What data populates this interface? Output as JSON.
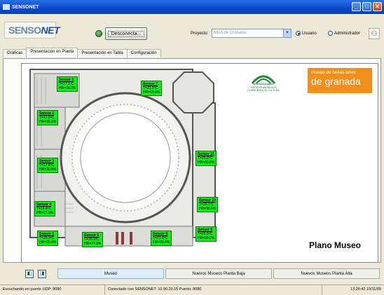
{
  "window": {
    "title": "SENSONET"
  },
  "toolbar": {
    "logo_main": "SENSO",
    "logo_accent": "NET",
    "disconnect_label": "Desconecta...",
    "project_label": "Proyecto:",
    "project_value": "MBA de Granada",
    "role_options": [
      "Usuario",
      "Administrador"
    ],
    "role_selected": "Usuario"
  },
  "tabs": [
    {
      "label": "Gráficas"
    },
    {
      "label": "Presentación en Planta"
    },
    {
      "label": "Presentación en Tabla"
    },
    {
      "label": "Configuración"
    }
  ],
  "active_tab": "Presentación en Planta",
  "plan": {
    "title": "Plano Museo",
    "logo_institution": "JUNTA DE ANDALUCIA",
    "logo_department": "CONSEJERÍA DE CULTURA",
    "museo_line1": "museo de bellas artes",
    "museo_line2": "de granada"
  },
  "sensors": [
    {
      "name": "Sensor 1",
      "t": "T=17.1ºC",
      "h": "HR=36.3%"
    },
    {
      "name": "Sensor 2",
      "t": "T=17.9ºC",
      "h": "HR=36.2%"
    },
    {
      "name": "Sensor 3",
      "t": "T=17.8ºC",
      "h": "HR=30.8%"
    },
    {
      "name": "Sensor 4",
      "t": "T=16.9ºC",
      "h": "HR=27.5%"
    },
    {
      "name": "Sensor 5",
      "t": "T=20.3ºC",
      "h": "HR=25.4%"
    },
    {
      "name": "Sensor 6",
      "t": "T=20.3ºC",
      "h": "HR=27.0%"
    },
    {
      "name": "Sensor 7",
      "t": "T=21.0ºC",
      "h": "HR=23.6%"
    },
    {
      "name": "Sensor 8",
      "t": "T=21.0ºC",
      "h": "HR=29.6%"
    },
    {
      "name": "Sensor 9",
      "t": "T=22.0ºC",
      "h": "HR=30.0%"
    },
    {
      "name": "Sensor 10",
      "t": "T=20.7ºC",
      "h": "HR=30.6%"
    },
    {
      "name": "Sensor 11",
      "t": "T=20.0ºC",
      "h": "HR=30.0%"
    }
  ],
  "bottom_nav": {
    "buttons": [
      "Museo",
      "Nuevos Museos Planta Baja",
      "Nuevos Museos Planta Alta"
    ],
    "active": "Museo"
  },
  "status": {
    "listening": "Escuchando en puerto UDP: 8080",
    "connection": "Conectado con SENSONET: 10.90.20.15 Puerto: 8080",
    "datetime": "13:26:42 19/11/09"
  },
  "colors": {
    "sensor_bg": "#16e81a",
    "museo_orange": "#f28f1c",
    "titlebar_blue": "#0a48c9"
  }
}
